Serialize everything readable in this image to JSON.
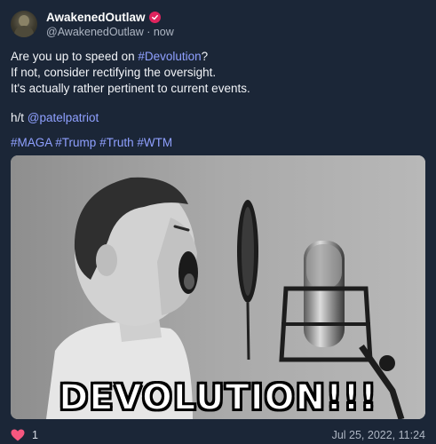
{
  "author": {
    "display_name": "AwakenedOutlaw",
    "handle": "@AwakenedOutlaw",
    "separator": " · ",
    "time": "now",
    "verified_icon": "verified-badge-icon",
    "avatar_icon": "soldier-avatar"
  },
  "tweet": {
    "line1_pre": "Are you up to speed on ",
    "line1_hashtag": "#Devolution",
    "line1_post": "?",
    "line2": "If not, consider rectifying the oversight.",
    "line3": "It's actually rather pertinent to current events.",
    "ht_prefix": "h/t ",
    "ht_mention": "@patelpatriot",
    "hashtags": [
      "#MAGA",
      "#Trump",
      "#Truth",
      "#WTM"
    ]
  },
  "media": {
    "caption": "DEVOLUTION!!!",
    "description_icon": "boy-shouting-into-microphone-image"
  },
  "footer": {
    "like_icon": "heart-icon",
    "like_count": "1",
    "timestamp": "Jul 25, 2022, 11:24"
  },
  "colors": {
    "background": "#1b2637",
    "link": "#8fa0ff",
    "verified": "#e0245e",
    "heart": "#f5577f"
  }
}
